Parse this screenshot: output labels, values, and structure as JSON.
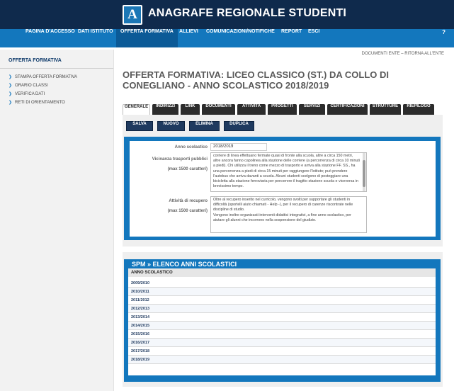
{
  "header": {
    "logo_letter": "A",
    "app_title": "ANAGRAFE REGIONALE STUDENTI"
  },
  "menu": {
    "items": [
      {
        "label": "PAGINA D'ACCESSO"
      },
      {
        "label": "DATI ISTITUTO"
      },
      {
        "label": "OFFERTA FORMATIVA",
        "active": true
      },
      {
        "label": "ALLIEVI"
      },
      {
        "label": "COMUNICAZIONI/NOTIFICHE"
      },
      {
        "label": "REPORT"
      },
      {
        "label": "ESCI"
      }
    ],
    "help": "?"
  },
  "breadcrumb": "DOCUMENTI ENTE – RITORNA ALL'ENTE",
  "sidebar": {
    "title": "OFFERTA FORMATIVA",
    "items": [
      {
        "label": "STAMPA OFFERTA FORMATIVA"
      },
      {
        "label": "ORARIO CLASSI"
      },
      {
        "label": "VERIFICA DATI"
      },
      {
        "label": "RETI DI ORIENTAMENTO"
      }
    ]
  },
  "page_title": "OFFERTA FORMATIVA: LICEO CLASSICO (ST.) DA COLLO DI CONEGLIANO - ANNO SCOLASTICO 2018/2019",
  "tabs": [
    {
      "label": "GENERALE",
      "active": true
    },
    {
      "label": "INDIRIZZI"
    },
    {
      "label": "LINK"
    },
    {
      "label": "DOCUMENTI"
    },
    {
      "label": "ATTIVITA"
    },
    {
      "label": "PROGETTI"
    },
    {
      "label": "SERVIZI"
    },
    {
      "label": "CERTIFICAZIONI"
    },
    {
      "label": "STRUTTURE"
    },
    {
      "label": "RIEPILOGO"
    }
  ],
  "actions": {
    "salva": "SALVA",
    "nuovo": "NUOVO",
    "elimina": "ELIMINA",
    "duplica": "DUPLICA"
  },
  "form": {
    "anno_label": "Anno scolastico",
    "anno_value": "2018/2019",
    "vicinanza_label": "Vicinanza trasporti pubblici",
    "vicinanza_hint": "(max 1500 caratteri)",
    "vicinanza_text": "corriere di linea effettuano fermate quasi di fronte alla scuola, altre a circa 150 metri, altre ancora fanno capolinea alla stazione delle corriere (a percorrenza di circa 10 minuti a piedi). Chi utilizza il treno come mezzo di trasporto e arriva alla stazione FF. SS., ha una percorrenza a piedi di circa 15 minuti per raggiungere l'Istituto; può prendere l'autobus che arriva davanti a scuola. Alcuni studenti scelgono di posteggiare una bicicletta alla stazione ferroviaria per percorrere il tragitto stazione scuola e viceversa in brevissimo tempo.",
    "recupero_label": "Attività di recupero",
    "recupero_hint": "(max 1500 caratteri)",
    "recupero_text": "Oltre al recupero inserito nel curricolo, vengono svolti per supportare gli studenti in difficoltà (sportelli aiuto chiamati - Help -), per il recupero di carenze riscontrate nelle discipline di studio.\nVengono inoltre organizzati interventi didattici integrativi, a fine anno scolastico, per aiutare gli alunni che incorrono nella sospensione del giudizio."
  },
  "list": {
    "title": "SPM » ELENCO ANNI SCOLASTICI",
    "header": "ANNO SCOLASTICO",
    "rows": [
      "2009/2010",
      "2010/2011",
      "2011/2012",
      "2012/2013",
      "2013/2014",
      "2014/2015",
      "2015/2016",
      "2016/2017",
      "2017/2018",
      "2018/2019"
    ]
  }
}
